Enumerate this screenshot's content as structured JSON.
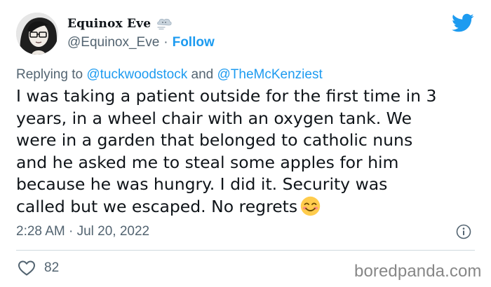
{
  "author": {
    "display_name": "Equinox Eve",
    "handle": "@Equinox_Eve",
    "separator": "·",
    "follow_label": "Follow",
    "name_emoji": "wind-blowing-face-emoji"
  },
  "reply": {
    "prefix": "Replying to",
    "mention_1": "@tuckwoodstock",
    "conjunction": "and",
    "mention_2": "@TheMcKenziest"
  },
  "tweet": {
    "lines": [
      "I was taking a patient outside for the first time in 3",
      "years, in a wheel chair with an oxygen tank. We",
      "were in a garden that belonged to catholic nuns",
      "and he asked me to steal some apples for him",
      "because he was hungry. I did it. Security was",
      "called but we escaped. No regrets"
    ],
    "end_emoji": "smiling-face-with-smiling-eyes-emoji"
  },
  "timestamp": "2:28 AM · Jul 20, 2022",
  "engagement": {
    "like_count": "82"
  },
  "watermark": "boredpanda.com",
  "colors": {
    "accent": "#1d9bf0",
    "text_primary": "#0f1419",
    "text_secondary": "#536471",
    "divider": "#cfd9de",
    "watermark": "#878787"
  },
  "icons": {
    "brand": "twitter-bird-icon",
    "info": "info-icon",
    "like": "heart-icon"
  }
}
